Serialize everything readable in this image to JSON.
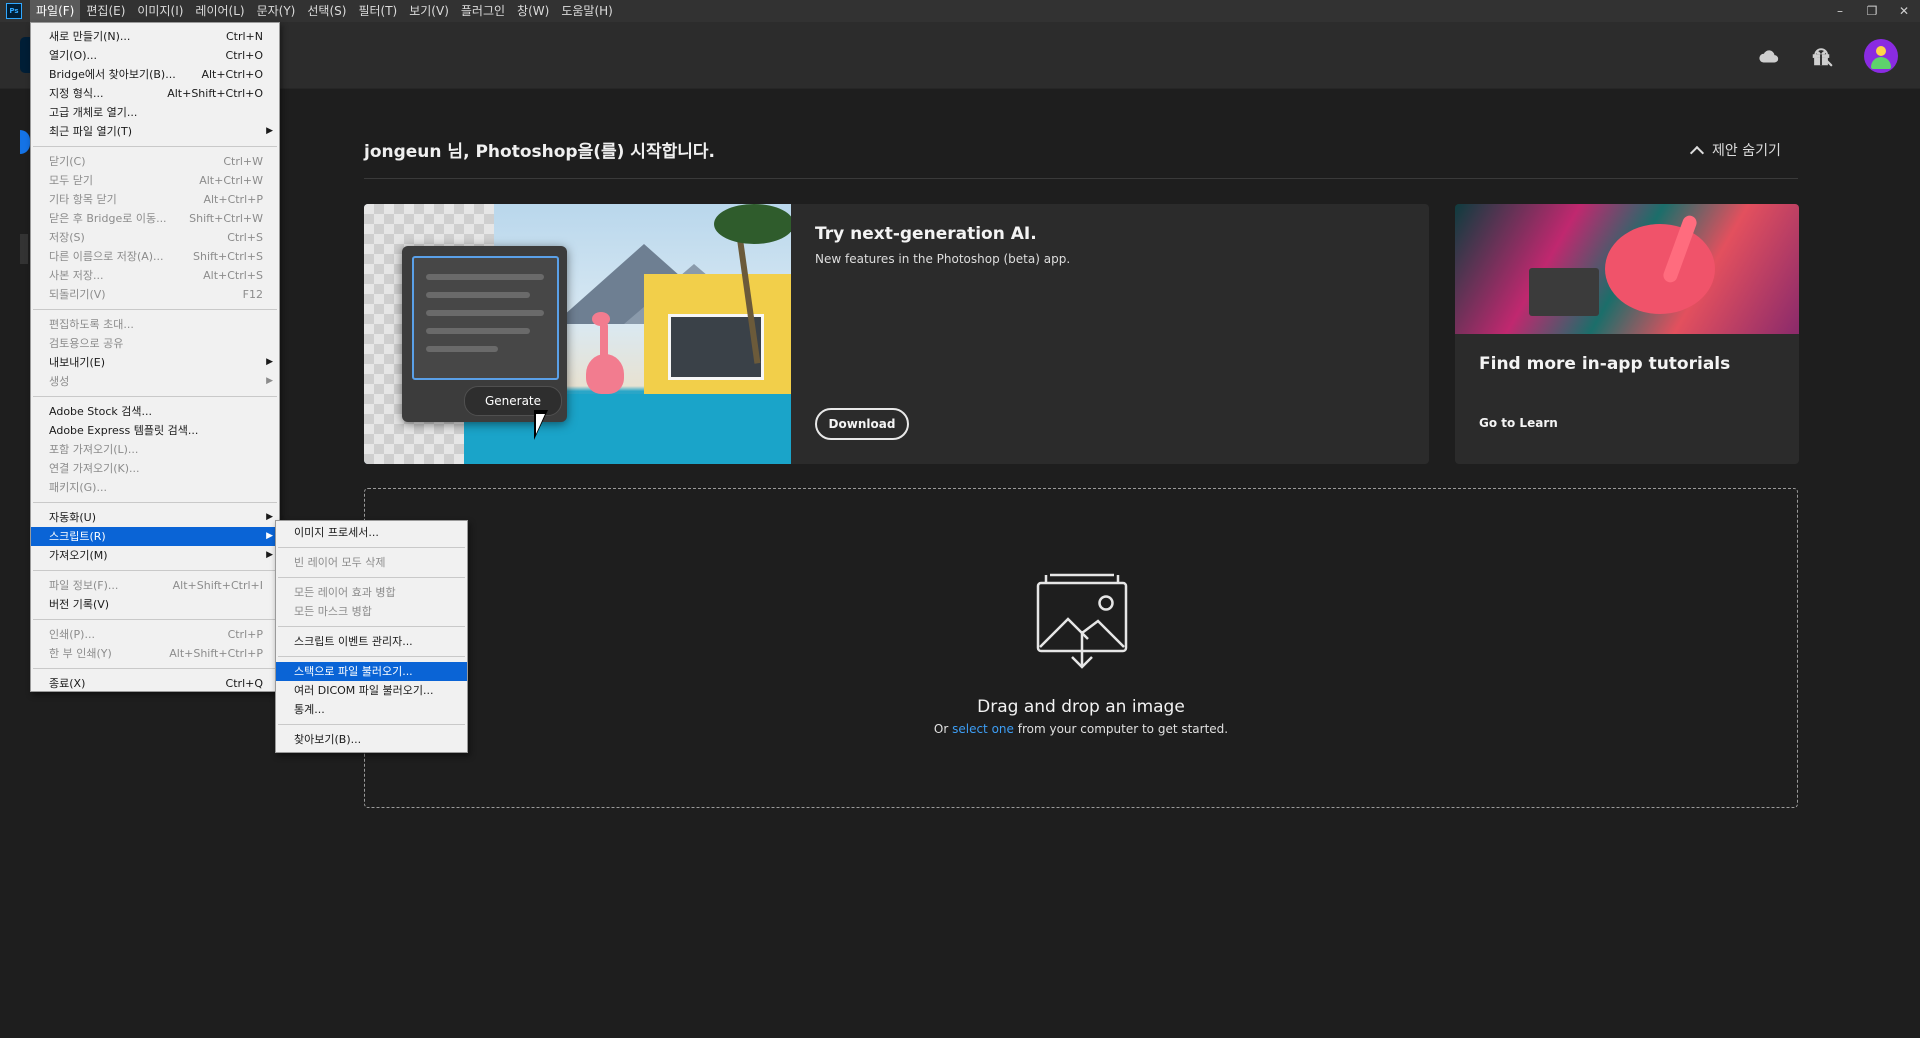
{
  "menubar": {
    "logo": "Ps",
    "items": [
      "파일(F)",
      "편집(E)",
      "이미지(I)",
      "레이어(L)",
      "문자(Y)",
      "선택(S)",
      "필터(T)",
      "보기(V)",
      "플러그인",
      "창(W)",
      "도움말(H)"
    ],
    "window_controls": [
      "–",
      "❐",
      "✕"
    ]
  },
  "header": {
    "icons": [
      "cloud-icon",
      "search-icon",
      "gift-icon",
      "avatar"
    ]
  },
  "home": {
    "welcome": "jongeun 님, Photoshop을(를) 시작합니다.",
    "hide_suggestions": "제안 숨기기"
  },
  "ai_card": {
    "title": "Try next-generation AI.",
    "subtitle": "New features in the Photoshop (beta) app.",
    "generate_label": "Generate",
    "button": "Download"
  },
  "tutorial_card": {
    "title": "Find more in-app tutorials",
    "link": "Go to Learn"
  },
  "dropzone": {
    "title": "Drag and drop an image",
    "sub_before": "Or",
    "sub_link": "select one",
    "sub_after": "from your computer to get started."
  },
  "file_menu": {
    "items": [
      {
        "label": "새로 만들기(N)...",
        "shortcut": "Ctrl+N",
        "disabled": false
      },
      {
        "label": "열기(O)...",
        "shortcut": "Ctrl+O",
        "disabled": false
      },
      {
        "label": "Bridge에서 찾아보기(B)...",
        "shortcut": "Alt+Ctrl+O",
        "disabled": false
      },
      {
        "label": "지정 형식...",
        "shortcut": "Alt+Shift+Ctrl+O",
        "disabled": false
      },
      {
        "label": "고급 개체로 열기...",
        "shortcut": "",
        "disabled": false
      },
      {
        "label": "최근 파일 열기(T)",
        "shortcut": "",
        "submenu": true,
        "disabled": false
      },
      {
        "sep": true
      },
      {
        "label": "닫기(C)",
        "shortcut": "Ctrl+W",
        "disabled": true
      },
      {
        "label": "모두 닫기",
        "shortcut": "Alt+Ctrl+W",
        "disabled": true
      },
      {
        "label": "기타 항목 닫기",
        "shortcut": "Alt+Ctrl+P",
        "disabled": true
      },
      {
        "label": "닫은 후 Bridge로 이동...",
        "shortcut": "Shift+Ctrl+W",
        "disabled": true
      },
      {
        "label": "저장(S)",
        "shortcut": "Ctrl+S",
        "disabled": true
      },
      {
        "label": "다른 이름으로 저장(A)...",
        "shortcut": "Shift+Ctrl+S",
        "disabled": true
      },
      {
        "label": "사본 저장...",
        "shortcut": "Alt+Ctrl+S",
        "disabled": true
      },
      {
        "label": "되돌리기(V)",
        "shortcut": "F12",
        "disabled": true
      },
      {
        "sep": true
      },
      {
        "label": "편집하도록 초대...",
        "shortcut": "",
        "disabled": true
      },
      {
        "label": "검토용으로 공유",
        "shortcut": "",
        "disabled": true
      },
      {
        "label": "내보내기(E)",
        "shortcut": "",
        "submenu": true,
        "disabled": false
      },
      {
        "label": "생성",
        "shortcut": "",
        "submenu": true,
        "disabled": true
      },
      {
        "sep": true
      },
      {
        "label": "Adobe Stock 검색...",
        "shortcut": "",
        "disabled": false
      },
      {
        "label": "Adobe Express 템플릿 검색...",
        "shortcut": "",
        "disabled": false
      },
      {
        "label": "포함 가져오기(L)...",
        "shortcut": "",
        "disabled": true
      },
      {
        "label": "연결 가져오기(K)...",
        "shortcut": "",
        "disabled": true
      },
      {
        "label": "패키지(G)...",
        "shortcut": "",
        "disabled": true
      },
      {
        "sep": true
      },
      {
        "label": "자동화(U)",
        "shortcut": "",
        "submenu": true,
        "disabled": false
      },
      {
        "label": "스크립트(R)",
        "shortcut": "",
        "submenu": true,
        "disabled": false,
        "highlight": true
      },
      {
        "label": "가져오기(M)",
        "shortcut": "",
        "submenu": true,
        "disabled": false
      },
      {
        "sep": true
      },
      {
        "label": "파일 정보(F)...",
        "shortcut": "Alt+Shift+Ctrl+I",
        "disabled": true
      },
      {
        "label": "버전 기록(V)",
        "shortcut": "",
        "disabled": false
      },
      {
        "sep": true
      },
      {
        "label": "인쇄(P)...",
        "shortcut": "Ctrl+P",
        "disabled": true
      },
      {
        "label": "한 부 인쇄(Y)",
        "shortcut": "Alt+Shift+Ctrl+P",
        "disabled": true
      },
      {
        "sep": true
      },
      {
        "label": "종료(X)",
        "shortcut": "Ctrl+Q",
        "disabled": false
      }
    ]
  },
  "scripts_menu": {
    "items": [
      {
        "label": "이미지 프로세서...",
        "disabled": false
      },
      {
        "sep": true
      },
      {
        "label": "빈 레이어 모두 삭제",
        "disabled": true
      },
      {
        "sep": true
      },
      {
        "label": "모든 레이어 효과 병합",
        "disabled": true
      },
      {
        "label": "모든 마스크 병합",
        "disabled": true
      },
      {
        "sep": true
      },
      {
        "label": "스크립트 이벤트 관리자...",
        "disabled": false
      },
      {
        "sep": true
      },
      {
        "label": "스택으로 파일 불러오기...",
        "disabled": false,
        "highlight": true
      },
      {
        "label": "여러 DICOM 파일 불러오기...",
        "disabled": false
      },
      {
        "label": "통계...",
        "disabled": false
      },
      {
        "sep": true
      },
      {
        "label": "찾아보기(B)...",
        "disabled": false
      }
    ]
  },
  "colors": {
    "accent": "#0a64d6",
    "link": "#3d9ef5",
    "background": "#1e1e1e"
  }
}
